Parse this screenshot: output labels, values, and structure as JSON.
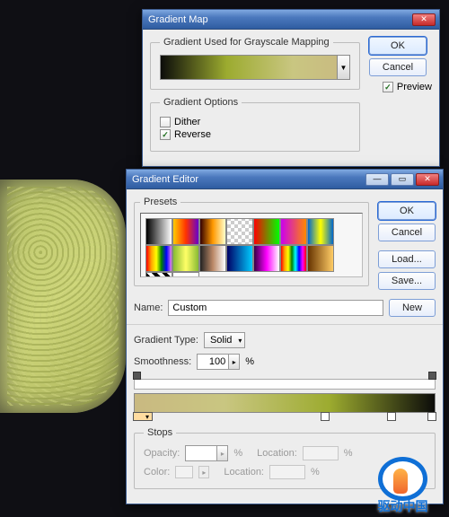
{
  "gmap": {
    "title": "Gradient Map",
    "fs1": "Gradient Used for Grayscale Mapping",
    "fs2": "Gradient Options",
    "dither": "Dither",
    "reverse": "Reverse",
    "reverse_checked": "✓",
    "ok": "OK",
    "cancel": "Cancel",
    "preview": "Preview",
    "preview_checked": "✓"
  },
  "ged": {
    "title": "Gradient Editor",
    "presets_label": "Presets",
    "ok": "OK",
    "cancel": "Cancel",
    "load": "Load...",
    "save": "Save...",
    "name_label": "Name:",
    "name_value": "Custom",
    "new": "New",
    "gtype_label": "Gradient Type:",
    "gtype_value": "Solid",
    "smooth_label": "Smoothness:",
    "smooth_value": "100",
    "pct": "%",
    "stops_label": "Stops",
    "opacity_label": "Opacity:",
    "location_label": "Location:",
    "color_label": "Color:",
    "presets": [
      "linear-gradient(90deg,#000,#fff)",
      "linear-gradient(90deg,#fc0,#f30,#60c)",
      "linear-gradient(90deg,#300,#f90,#ffc)",
      "repeating-conic-gradient(#ccc 0 25%,#fff 0 50%) 0/8px 8px",
      "linear-gradient(90deg,#f00,#0f0)",
      "linear-gradient(90deg,#c0e,#f80)",
      "linear-gradient(90deg,#06c,#ff0,#06c)",
      "linear-gradient(90deg,red,orange,yellow,green,blue,violet)",
      "linear-gradient(90deg,#8b3,#ff6,#8b3)",
      "linear-gradient(90deg,#222,#b86,#fff)",
      "linear-gradient(90deg,#006,#0cf)",
      "linear-gradient(90deg,#304,#f0f,#fff)",
      "linear-gradient(90deg,red,orange,yellow,green,cyan,blue,magenta,red)",
      "linear-gradient(90deg,#630,#fc6)",
      "repeating-linear-gradient(45deg,#000 0 4px,#fff 4px 8px)",
      "linear-gradient(90deg,#fff,#fff)"
    ]
  },
  "watermark": "驱动中国"
}
